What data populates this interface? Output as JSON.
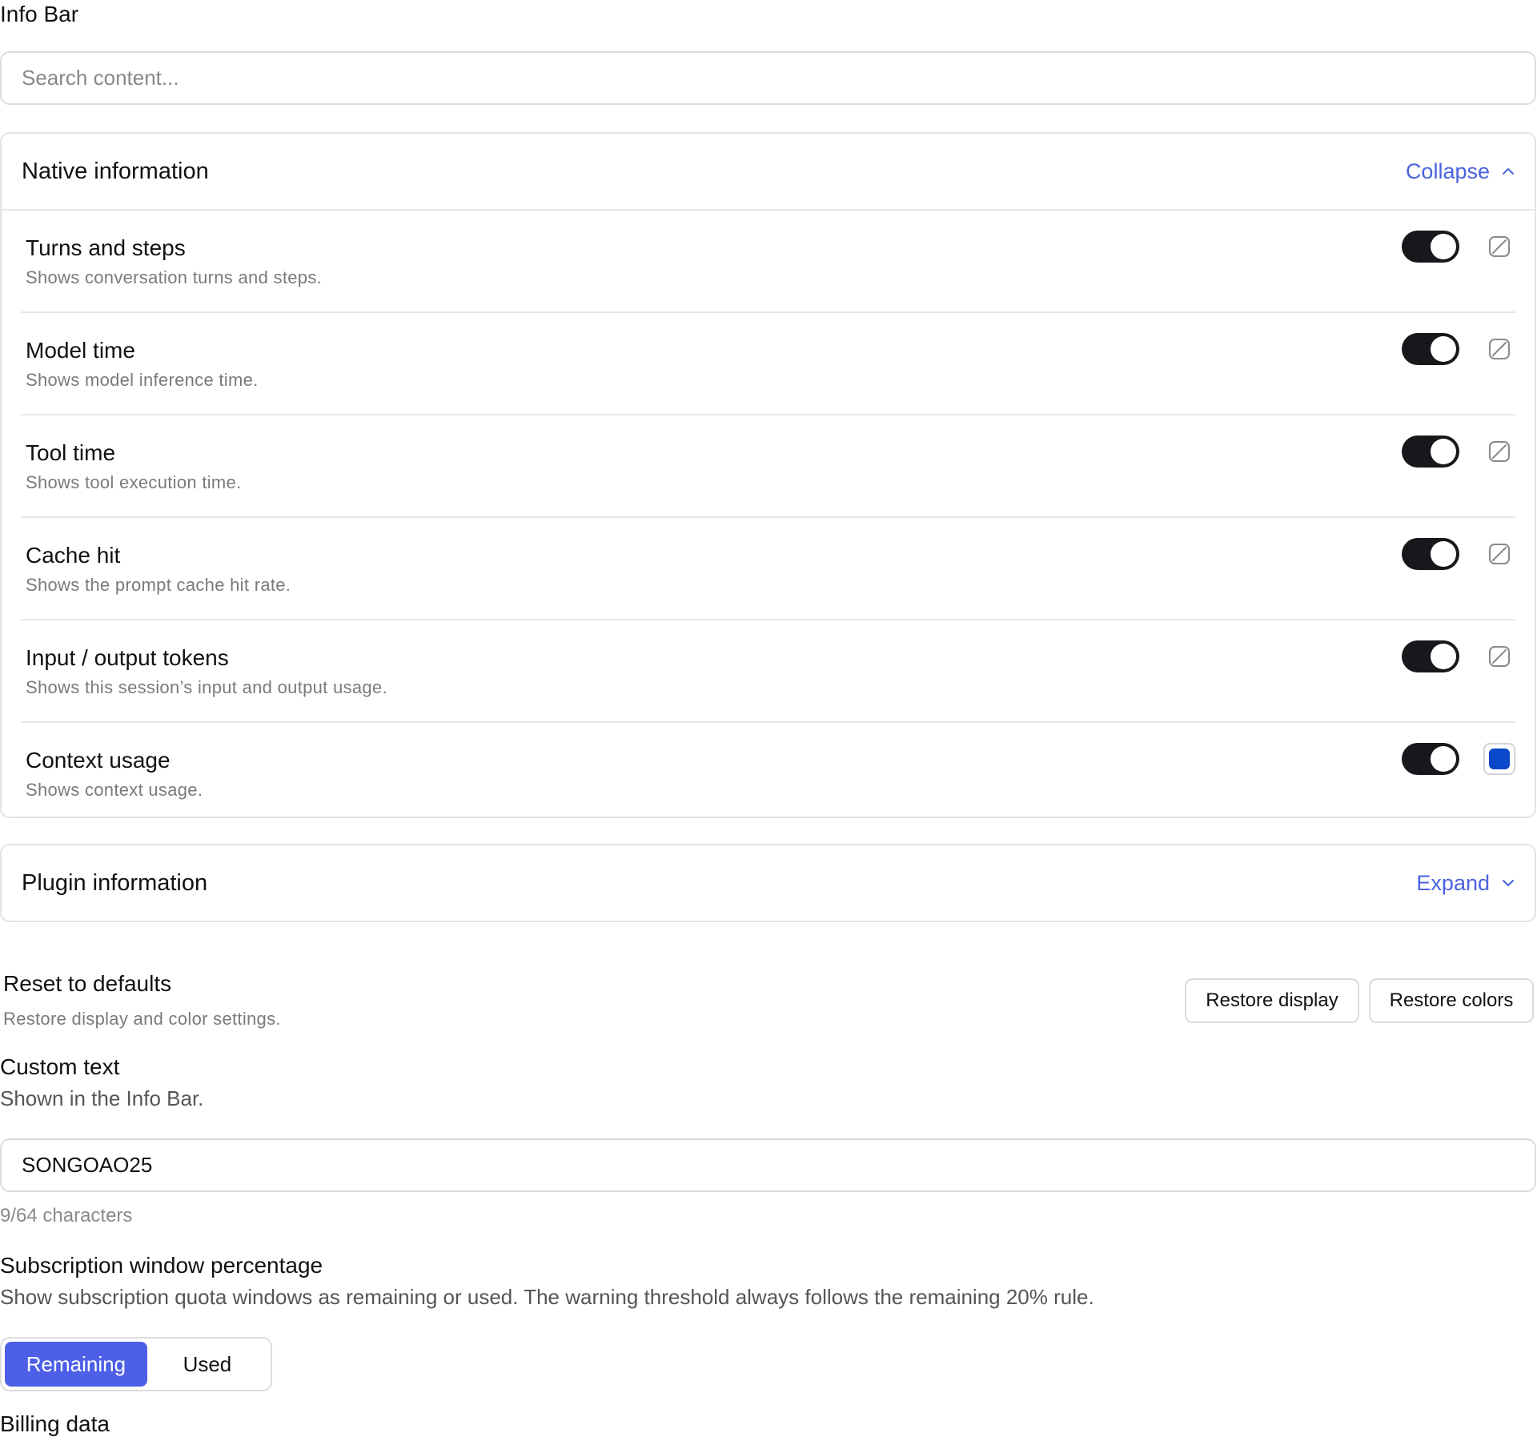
{
  "page": {
    "title": "Info Bar"
  },
  "search": {
    "placeholder": "Search content...",
    "value": ""
  },
  "native": {
    "title": "Native information",
    "toggle_label": "Collapse",
    "items": [
      {
        "label": "Turns and steps",
        "description": "Shows conversation turns and steps.",
        "enabled": true,
        "color": "none"
      },
      {
        "label": "Model time",
        "description": "Shows model inference time.",
        "enabled": true,
        "color": "none"
      },
      {
        "label": "Tool time",
        "description": "Shows tool execution time.",
        "enabled": true,
        "color": "none"
      },
      {
        "label": "Cache hit",
        "description": "Shows the prompt cache hit rate.",
        "enabled": true,
        "color": "none"
      },
      {
        "label": "Input / output tokens",
        "description": "Shows this session’s input and output usage.",
        "enabled": true,
        "color": "none"
      },
      {
        "label": "Context usage",
        "description": "Shows context usage.",
        "enabled": true,
        "color": "#0a47c9"
      }
    ]
  },
  "plugin": {
    "title": "Plugin information",
    "toggle_label": "Expand"
  },
  "reset": {
    "title": "Reset to defaults",
    "description": "Restore display and color settings.",
    "restore_display_label": "Restore display",
    "restore_colors_label": "Restore colors"
  },
  "custom_text": {
    "title": "Custom text",
    "description": "Shown in the Info Bar.",
    "value": "SONGOAO25",
    "char_count": "9/64 characters"
  },
  "subscription": {
    "title": "Subscription window percentage",
    "description": "Show subscription quota windows as remaining or used. The warning threshold always follows the remaining 20% rule.",
    "options": [
      "Remaining",
      "Used"
    ],
    "selected": "Remaining"
  },
  "billing": {
    "title": "Billing data"
  },
  "colors": {
    "accent": "#4a63de",
    "segment_active": "#4c5fe6",
    "switch_on": "#17181b"
  }
}
